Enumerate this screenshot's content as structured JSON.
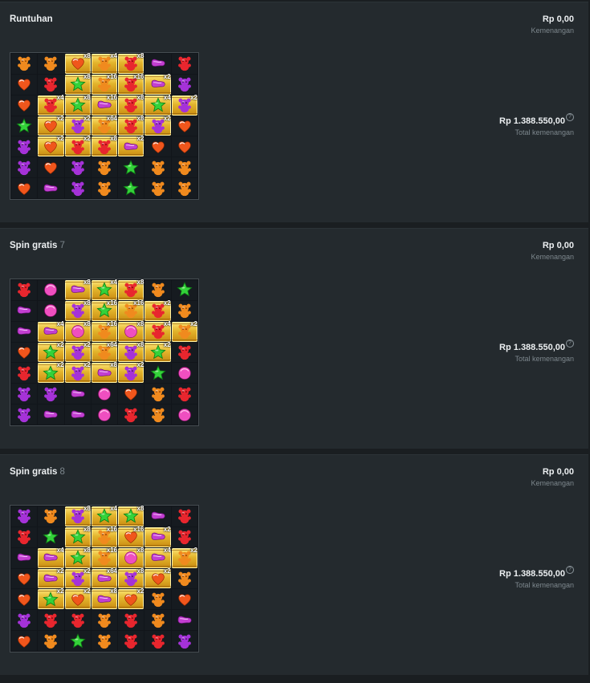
{
  "colors": {
    "background": "#1a1e21",
    "panel": "#242a2e",
    "muted_text": "#7d878d",
    "multiplier_tile": "#e3b52c"
  },
  "symbol_legend": {
    "B": "orange-bear-icon",
    "R": "red-bear-icon",
    "P": "purple-bear-icon",
    "G": "green-star-icon",
    "H": "orange-heart-candy-icon",
    "S": "purple-sausage-candy-icon",
    "K": "pink-round-candy-icon"
  },
  "panels": [
    {
      "title": "Runtuhan",
      "count": "",
      "win_value": "Rp 0,00",
      "win_label": "Kemenangan",
      "total_value": "Rp 1.388.550,00",
      "total_label": "Total kemenangan",
      "help_icon": "?",
      "grid": [
        [
          {
            "s": "B"
          },
          {
            "s": "B"
          },
          {
            "s": "H",
            "g": 1,
            "m": "x8"
          },
          {
            "s": "B",
            "g": 1,
            "m": "x4"
          },
          {
            "s": "R",
            "g": 1,
            "m": "x8"
          },
          {
            "s": "S"
          },
          {
            "s": "R"
          }
        ],
        [
          {
            "s": "H"
          },
          {
            "s": "R"
          },
          {
            "s": "G",
            "g": 1,
            "m": "x8"
          },
          {
            "s": "B",
            "g": 1,
            "m": "x16"
          },
          {
            "s": "R",
            "g": 1,
            "m": "x16"
          },
          {
            "s": "S",
            "g": 1,
            "m": "x2"
          },
          {
            "s": "P"
          }
        ],
        [
          {
            "s": "H"
          },
          {
            "s": "R",
            "g": 1,
            "m": "x4"
          },
          {
            "s": "G",
            "g": 1,
            "m": "x8"
          },
          {
            "s": "S",
            "g": 1,
            "m": "x16"
          },
          {
            "s": "R",
            "g": 1,
            "m": "x8"
          },
          {
            "s": "G",
            "g": 1,
            "m": "x4"
          },
          {
            "s": "P",
            "g": 1,
            "m": "x2"
          }
        ],
        [
          {
            "s": "G"
          },
          {
            "s": "H",
            "g": 1,
            "m": "x2"
          },
          {
            "s": "P",
            "g": 1,
            "m": "x2"
          },
          {
            "s": "B",
            "g": 1,
            "m": "x64"
          },
          {
            "s": "R",
            "g": 1,
            "m": "x8"
          },
          {
            "s": "P",
            "g": 1,
            "m": "x2"
          },
          {
            "s": "H"
          }
        ],
        [
          {
            "s": "P"
          },
          {
            "s": "H",
            "g": 1,
            "m": "x2"
          },
          {
            "s": "R",
            "g": 1,
            "m": "x2"
          },
          {
            "s": "R",
            "g": 1,
            "m": "x8"
          },
          {
            "s": "S",
            "g": 1,
            "m": "x2"
          },
          {
            "s": "H"
          },
          {
            "s": "H"
          }
        ],
        [
          {
            "s": "P"
          },
          {
            "s": "H"
          },
          {
            "s": "P"
          },
          {
            "s": "B"
          },
          {
            "s": "G"
          },
          {
            "s": "B"
          },
          {
            "s": "B"
          }
        ],
        [
          {
            "s": "H"
          },
          {
            "s": "S"
          },
          {
            "s": "P"
          },
          {
            "s": "B"
          },
          {
            "s": "G"
          },
          {
            "s": "B"
          },
          {
            "s": "B"
          }
        ]
      ]
    },
    {
      "title": "Spin gratis",
      "count": "7",
      "win_value": "Rp 0,00",
      "win_label": "Kemenangan",
      "total_value": "Rp 1.388.550,00",
      "total_label": "Total kemenangan",
      "help_icon": "?",
      "grid": [
        [
          {
            "s": "R"
          },
          {
            "s": "K"
          },
          {
            "s": "S",
            "g": 1,
            "m": "x8"
          },
          {
            "s": "G",
            "g": 1,
            "m": "x4"
          },
          {
            "s": "R",
            "g": 1,
            "m": "x8"
          },
          {
            "s": "B"
          },
          {
            "s": "G"
          }
        ],
        [
          {
            "s": "S"
          },
          {
            "s": "K"
          },
          {
            "s": "P",
            "g": 1,
            "m": "x8"
          },
          {
            "s": "G",
            "g": 1,
            "m": "x16"
          },
          {
            "s": "B",
            "g": 1,
            "m": "x16"
          },
          {
            "s": "R",
            "g": 1,
            "m": "x2"
          },
          {
            "s": "B"
          }
        ],
        [
          {
            "s": "S"
          },
          {
            "s": "S",
            "g": 1,
            "m": "x4"
          },
          {
            "s": "K",
            "g": 1,
            "m": "x8"
          },
          {
            "s": "B",
            "g": 1,
            "m": "x16"
          },
          {
            "s": "K",
            "g": 1,
            "m": "x8"
          },
          {
            "s": "R",
            "g": 1,
            "m": "x4"
          },
          {
            "s": "B",
            "g": 1,
            "m": "x2"
          }
        ],
        [
          {
            "s": "H"
          },
          {
            "s": "G",
            "g": 1,
            "m": "x2"
          },
          {
            "s": "P",
            "g": 1,
            "m": "x2"
          },
          {
            "s": "B",
            "g": 1,
            "m": "x64"
          },
          {
            "s": "P",
            "g": 1,
            "m": "x8"
          },
          {
            "s": "G",
            "g": 1,
            "m": "x2"
          },
          {
            "s": "R"
          }
        ],
        [
          {
            "s": "R"
          },
          {
            "s": "G",
            "g": 1,
            "m": "x2"
          },
          {
            "s": "P",
            "g": 1,
            "m": "x2"
          },
          {
            "s": "S",
            "g": 1,
            "m": "x8"
          },
          {
            "s": "P",
            "g": 1,
            "m": "x2"
          },
          {
            "s": "G"
          },
          {
            "s": "K"
          }
        ],
        [
          {
            "s": "P"
          },
          {
            "s": "P"
          },
          {
            "s": "S"
          },
          {
            "s": "K"
          },
          {
            "s": "H"
          },
          {
            "s": "B"
          },
          {
            "s": "R"
          }
        ],
        [
          {
            "s": "P"
          },
          {
            "s": "S"
          },
          {
            "s": "S"
          },
          {
            "s": "K"
          },
          {
            "s": "R"
          },
          {
            "s": "B"
          },
          {
            "s": "K"
          }
        ]
      ]
    },
    {
      "title": "Spin gratis",
      "count": "8",
      "win_value": "Rp 0,00",
      "win_label": "Kemenangan",
      "total_value": "Rp 1.388.550,00",
      "total_label": "Total kemenangan",
      "help_icon": "?",
      "grid": [
        [
          {
            "s": "P"
          },
          {
            "s": "B"
          },
          {
            "s": "P",
            "g": 1,
            "m": "x8"
          },
          {
            "s": "G",
            "g": 1,
            "m": "x4"
          },
          {
            "s": "G",
            "g": 1,
            "m": "x8"
          },
          {
            "s": "S"
          },
          {
            "s": "R"
          }
        ],
        [
          {
            "s": "R"
          },
          {
            "s": "G"
          },
          {
            "s": "G",
            "g": 1,
            "m": "x8"
          },
          {
            "s": "B",
            "g": 1,
            "m": "x16"
          },
          {
            "s": "H",
            "g": 1,
            "m": "x16"
          },
          {
            "s": "S",
            "g": 1,
            "m": "x2"
          },
          {
            "s": "R"
          }
        ],
        [
          {
            "s": "S"
          },
          {
            "s": "S",
            "g": 1,
            "m": "x4"
          },
          {
            "s": "G",
            "g": 1,
            "m": "x8"
          },
          {
            "s": "B",
            "g": 1,
            "m": "x16"
          },
          {
            "s": "K",
            "g": 1,
            "m": "x8"
          },
          {
            "s": "S",
            "g": 1,
            "m": "x4"
          },
          {
            "s": "B",
            "g": 1,
            "m": "x2"
          }
        ],
        [
          {
            "s": "H"
          },
          {
            "s": "S",
            "g": 1,
            "m": "x2"
          },
          {
            "s": "P",
            "g": 1,
            "m": "x2"
          },
          {
            "s": "S",
            "g": 1,
            "m": "x64"
          },
          {
            "s": "P",
            "g": 1,
            "m": "x8"
          },
          {
            "s": "H",
            "g": 1,
            "m": "x2"
          },
          {
            "s": "B"
          }
        ],
        [
          {
            "s": "H"
          },
          {
            "s": "G",
            "g": 1,
            "m": "x2"
          },
          {
            "s": "H",
            "g": 1,
            "m": "x2"
          },
          {
            "s": "S",
            "g": 1,
            "m": "x8"
          },
          {
            "s": "H",
            "g": 1,
            "m": "x2"
          },
          {
            "s": "B"
          },
          {
            "s": "H"
          }
        ],
        [
          {
            "s": "P"
          },
          {
            "s": "R"
          },
          {
            "s": "R"
          },
          {
            "s": "B"
          },
          {
            "s": "R"
          },
          {
            "s": "B"
          },
          {
            "s": "S"
          }
        ],
        [
          {
            "s": "H"
          },
          {
            "s": "B"
          },
          {
            "s": "G"
          },
          {
            "s": "B"
          },
          {
            "s": "R"
          },
          {
            "s": "R"
          },
          {
            "s": "P"
          }
        ]
      ]
    }
  ]
}
